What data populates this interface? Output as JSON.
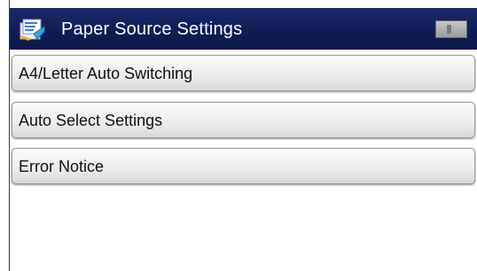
{
  "title_bar": {
    "title": "Paper Source Settings",
    "icon": "paper-settings-icon",
    "status_icon": "status-indicator-icon"
  },
  "menu": {
    "items": [
      {
        "label": "A4/Letter Auto Switching"
      },
      {
        "label": "Auto Select Settings"
      },
      {
        "label": "Error Notice"
      }
    ]
  },
  "colors": {
    "title_bar_background": "#101c55",
    "title_text": "#ffffff",
    "menu_item_background": "#ececec",
    "menu_item_text": "#111111"
  }
}
